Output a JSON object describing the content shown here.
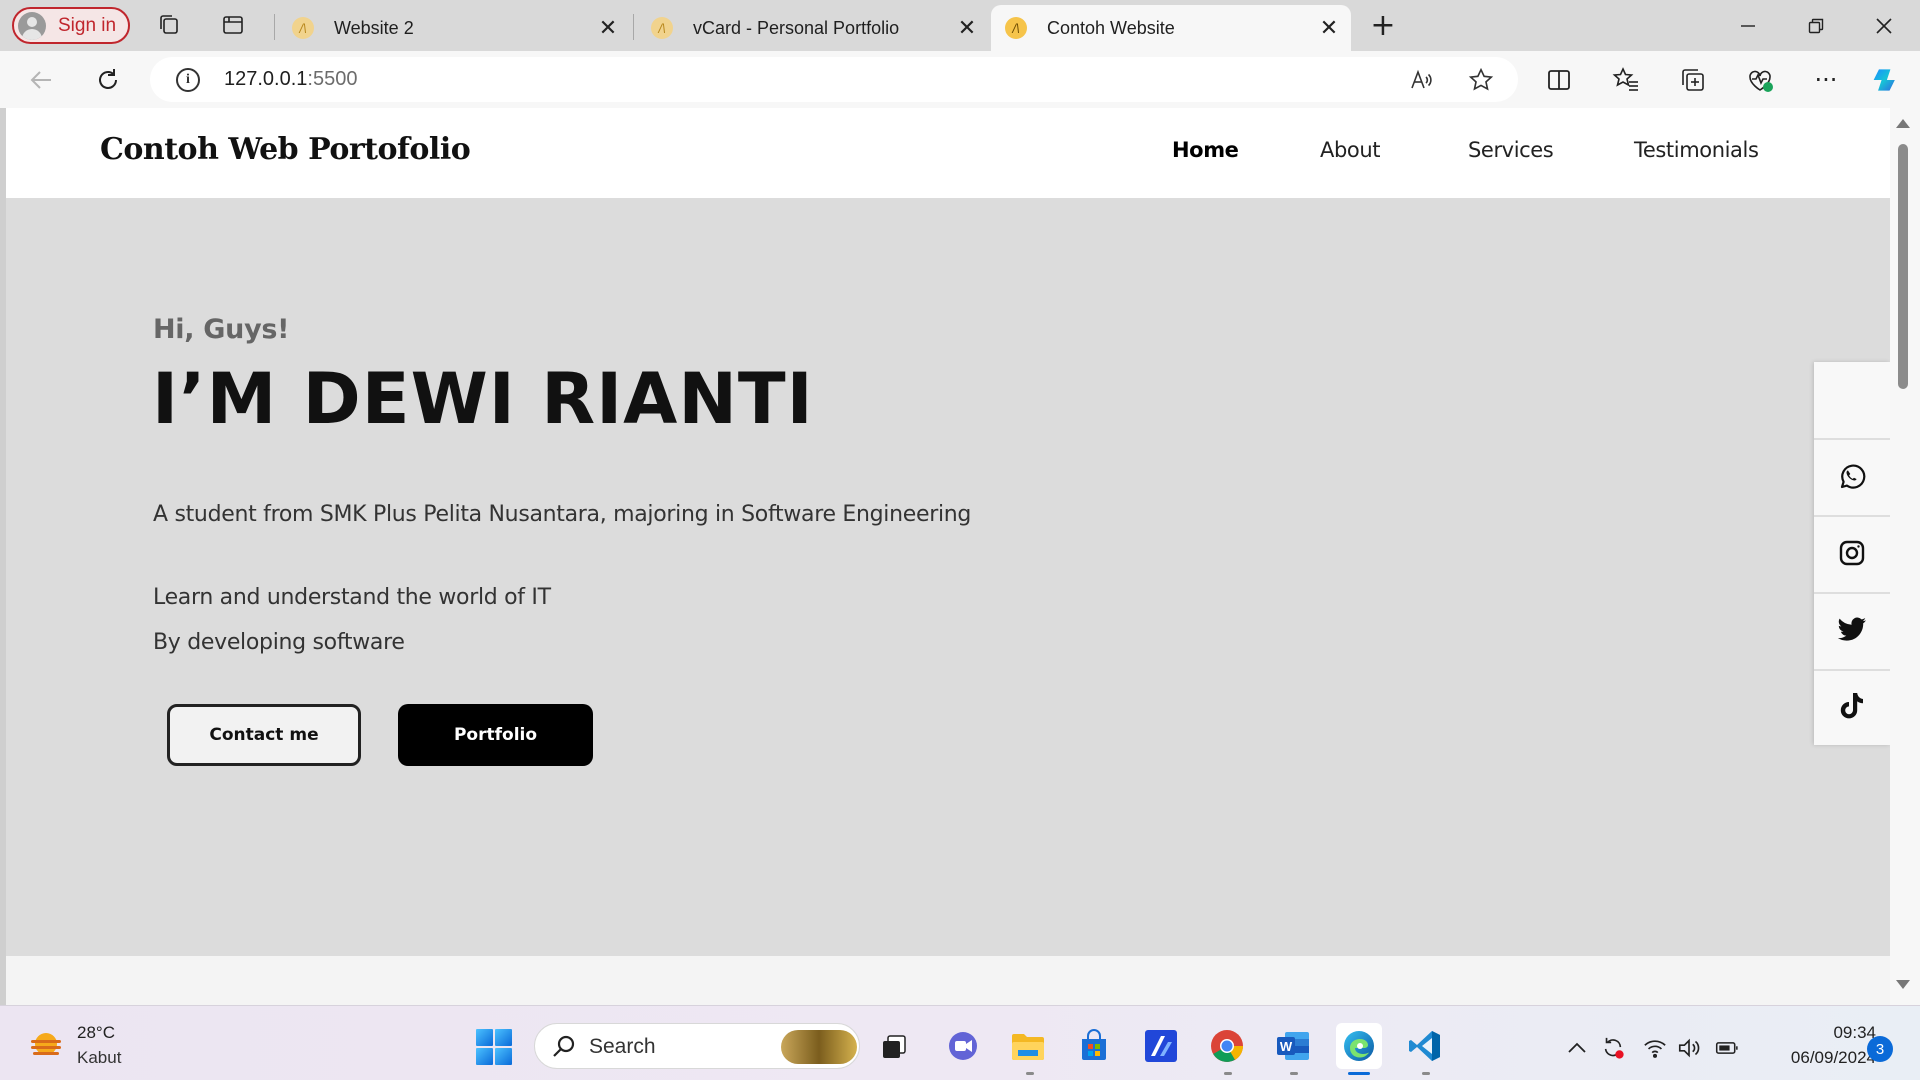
{
  "browser": {
    "signin_label": "Sign in",
    "tabs": [
      {
        "title": "Website 2",
        "favicon": "vscode-live-favicon"
      },
      {
        "title": "vCard - Personal Portfolio",
        "favicon": "vscode-live-favicon"
      },
      {
        "title": "Contoh Website",
        "favicon": "vscode-live-favicon",
        "active": true
      }
    ],
    "address": {
      "host": "127.0.0.1",
      "port": ":5500"
    }
  },
  "site": {
    "brand": "Contoh Web Portofolio",
    "nav": [
      "Home",
      "About",
      "Services",
      "Testimonials"
    ],
    "hero": {
      "greeting": "Hi, Guys!",
      "name": "I’M DEWI RIANTI",
      "tagline": "A student from SMK Plus Pelita Nusantara, majoring in Software Engineering",
      "line1": "Learn and understand the world of IT",
      "line2": "By developing software",
      "contact_button": "Contact me",
      "portfolio_button": "Portfolio"
    },
    "social_icons": [
      "whatsapp-icon",
      "instagram-icon",
      "twitter-icon",
      "tiktok-icon"
    ]
  },
  "taskbar": {
    "weather": {
      "temp": "28°C",
      "desc": "Kabut"
    },
    "search_label": "Search",
    "clock": {
      "time": "09:34",
      "date": "06/09/2024"
    },
    "notification_count": "3"
  },
  "colors": {
    "accent_red": "#c0262d",
    "hero_bg": "#dcdcdc",
    "windows_blue": "#0a6ad8"
  }
}
